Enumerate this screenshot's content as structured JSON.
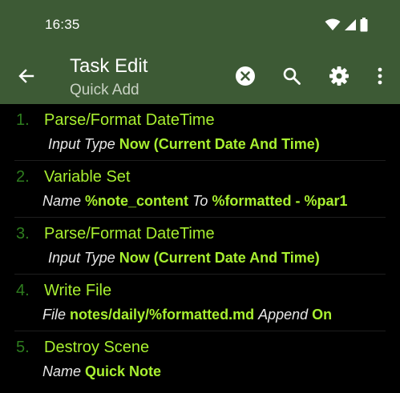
{
  "status_bar": {
    "time": "16:35"
  },
  "toolbar": {
    "title": "Task Edit",
    "subtitle": "Quick Add",
    "back_icon": "arrow-left-icon",
    "close_icon": "close-circle-icon",
    "search_icon": "search-icon",
    "settings_icon": "gear-icon",
    "more_icon": "more-vertical-icon"
  },
  "colors": {
    "appbar": "#3d5a35",
    "background": "#000000",
    "accent": "#a8f030",
    "number": "#2e7d1e"
  },
  "actions": [
    {
      "number": "1.",
      "name": "Parse/Format DateTime",
      "params": [
        {
          "label": "Input Type",
          "value": "Now (Current Date And Time)"
        }
      ]
    },
    {
      "number": "2.",
      "name": "Variable Set",
      "params": [
        {
          "label": "Name",
          "value": "%note_content"
        },
        {
          "label": "To",
          "value": "%formatted - %par1"
        }
      ]
    },
    {
      "number": "3.",
      "name": "Parse/Format DateTime",
      "params": [
        {
          "label": "Input Type",
          "value": "Now (Current Date And Time)"
        }
      ]
    },
    {
      "number": "4.",
      "name": "Write File",
      "params": [
        {
          "label": "File",
          "value": "notes/daily/%formatted.md"
        },
        {
          "label": "Append",
          "value": "On"
        }
      ]
    },
    {
      "number": "5.",
      "name": "Destroy Scene",
      "params": [
        {
          "label": "Name",
          "value": "Quick Note"
        }
      ]
    }
  ]
}
